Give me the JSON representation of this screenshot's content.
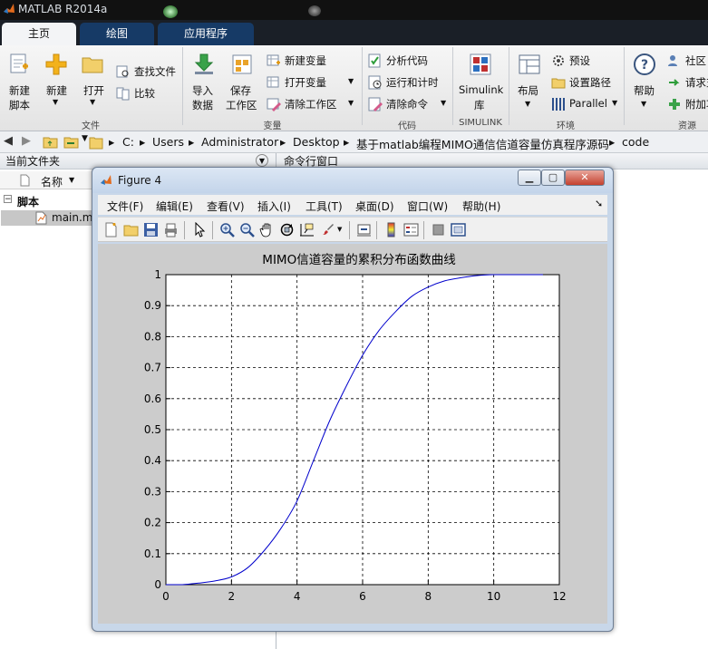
{
  "app": {
    "title": "MATLAB R2014a"
  },
  "tabs": [
    {
      "label": "主页"
    },
    {
      "label": "绘图"
    },
    {
      "label": "应用程序"
    }
  ],
  "ribbon": {
    "new_script": "新建\n脚本",
    "new_script_1": "新建",
    "new_script_2": "脚本",
    "new": "新建",
    "open": "打开",
    "find_files": "查找文件",
    "compare": "比较",
    "import_1": "导入",
    "import_2": "数据",
    "save_1": "保存",
    "save_2": "工作区",
    "new_variable": "新建变量",
    "open_variable": "打开变量",
    "clear_workspace": "清除工作区",
    "analyze_code": "分析代码",
    "run_and_time": "运行和计时",
    "clear_commands": "清除命令",
    "simulink_1": "Simulink",
    "simulink_2": "库",
    "layout": "布局",
    "preferences": "预设",
    "set_path": "设置路径",
    "parallel": "Parallel",
    "help": "帮助",
    "community": "社区",
    "request_support": "请求支",
    "addons": "附加功",
    "groups": {
      "file": "文件",
      "variable": "变量",
      "code": "代码",
      "simulink": "SIMULINK",
      "environment": "环境",
      "resources": "资源"
    }
  },
  "address": {
    "crumbs": [
      "C:",
      "Users",
      "Administrator",
      "Desktop",
      "基于matlab编程MIMO通信信道容量仿真程序源码",
      "code"
    ]
  },
  "left_panel": {
    "title": "当前文件夹",
    "column_name": "名称",
    "sort_arrow": "▼",
    "group": "脚本",
    "file": "main.m"
  },
  "cmd_panel": {
    "title": "命令行窗口"
  },
  "figure": {
    "title": "Figure 4",
    "menus": [
      "文件(F)",
      "编辑(E)",
      "查看(V)",
      "插入(I)",
      "工具(T)",
      "桌面(D)",
      "窗口(W)",
      "帮助(H)"
    ]
  },
  "chart_data": {
    "type": "line",
    "title": "MIMO信道容量的累积分布函数曲线",
    "xlabel": "",
    "ylabel": "",
    "xlim": [
      0,
      12
    ],
    "ylim": [
      0,
      1
    ],
    "xticks": [
      0,
      2,
      4,
      6,
      8,
      10,
      12
    ],
    "yticks": [
      0,
      0.1,
      0.2,
      0.3,
      0.4,
      0.5,
      0.6,
      0.7,
      0.8,
      0.9,
      1
    ],
    "grid": true,
    "grid_style": "dashed",
    "series": [
      {
        "color": "#0000cc",
        "x": [
          0.0,
          0.5,
          1.0,
          1.5,
          2.0,
          2.5,
          3.0,
          3.5,
          4.0,
          4.5,
          5.0,
          5.5,
          6.0,
          6.5,
          7.0,
          7.5,
          8.0,
          8.5,
          9.0,
          9.5,
          10.0,
          10.5,
          11.0,
          11.5
        ],
        "y": [
          0.0,
          0.0,
          0.005,
          0.012,
          0.025,
          0.055,
          0.11,
          0.18,
          0.27,
          0.4,
          0.53,
          0.64,
          0.74,
          0.82,
          0.88,
          0.93,
          0.96,
          0.98,
          0.99,
          0.997,
          1.0,
          1.0,
          1.0,
          1.0
        ]
      }
    ]
  }
}
